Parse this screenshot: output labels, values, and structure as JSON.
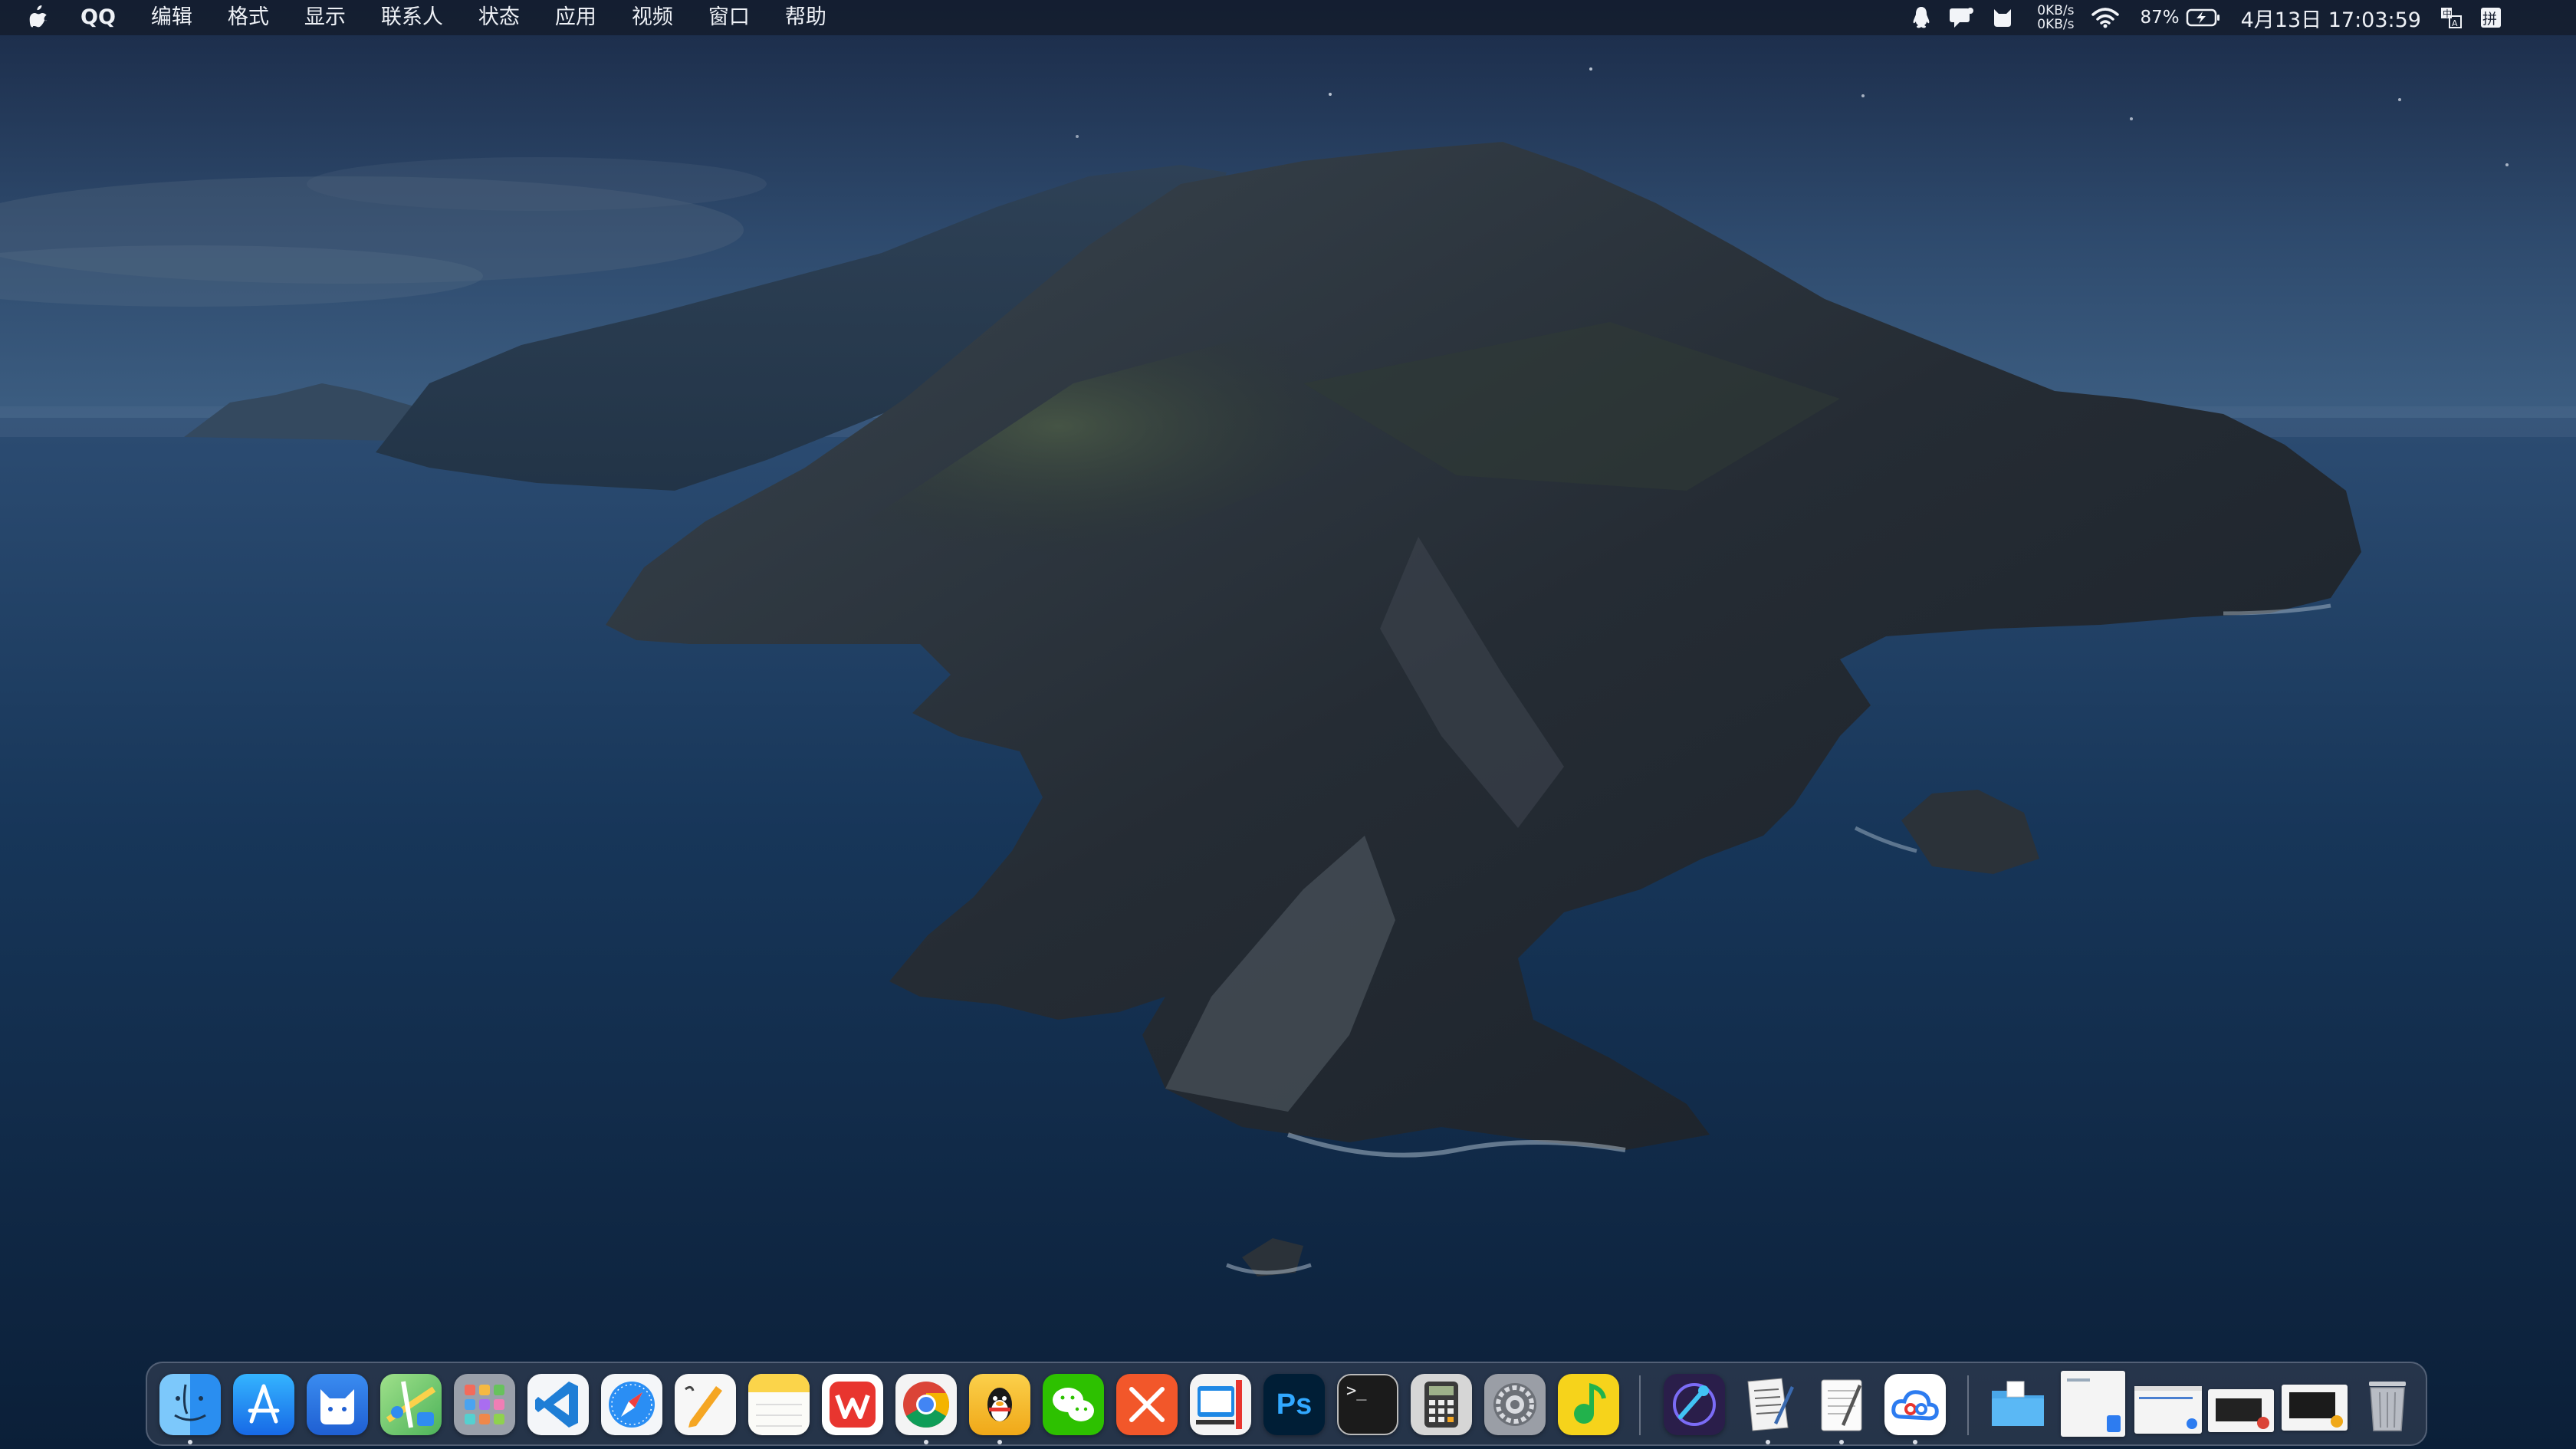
{
  "menubar": {
    "app_name": "QQ",
    "menus": [
      "编辑",
      "格式",
      "显示",
      "联系人",
      "状态",
      "应用",
      "视频",
      "窗口",
      "帮助"
    ],
    "net_up": "0KB/s",
    "net_down": "0KB/s",
    "battery": "87%",
    "datetime": "4月13日 17:03:59",
    "status_icons": [
      "qq-penguin-icon",
      "notification-chat-icon",
      "cat-icon",
      "wifi-icon",
      "battery-charging-icon",
      "input-method-icon",
      "pinyin-icon"
    ]
  },
  "dock": {
    "apps": [
      {
        "name": "Finder",
        "icon": "finder-icon",
        "color": "#3aa0f3",
        "running": true
      },
      {
        "name": "App Store",
        "icon": "app-store-icon",
        "color": "#1d8cf5",
        "running": false
      },
      {
        "name": "Cat App",
        "icon": "cat-app-icon",
        "color": "#2f7be8",
        "running": false
      },
      {
        "name": "Maps",
        "icon": "maps-icon",
        "color": "#6cc46a",
        "running": false
      },
      {
        "name": "Launchpad",
        "icon": "launchpad-icon",
        "color": "#8a8f98",
        "running": false
      },
      {
        "name": "Visual Studio Code",
        "icon": "vscode-icon",
        "color": "#1f7ed6",
        "running": false
      },
      {
        "name": "Safari",
        "icon": "safari-icon",
        "color": "#1f8ef1",
        "running": false
      },
      {
        "name": "Pages",
        "icon": "pages-icon",
        "color": "#f4f4f4",
        "running": false
      },
      {
        "name": "Notes",
        "icon": "notes-icon",
        "color": "#fbd44a",
        "running": false
      },
      {
        "name": "WPS Office",
        "icon": "wps-icon",
        "color": "#e8352f",
        "running": false
      },
      {
        "name": "Google Chrome",
        "icon": "chrome-icon",
        "color": "#f1f1f1",
        "running": true
      },
      {
        "name": "QQ",
        "icon": "qq-icon",
        "color": "#f2b51d",
        "running": true
      },
      {
        "name": "WeChat",
        "icon": "wechat-icon",
        "color": "#2dc100",
        "running": false
      },
      {
        "name": "XMind",
        "icon": "xmind-icon",
        "color": "#f2572a",
        "running": false
      },
      {
        "name": "Screen Tool",
        "icon": "screen-tool-icon",
        "color": "#1e88e5",
        "running": false
      },
      {
        "name": "Photoshop",
        "icon": "photoshop-icon",
        "color": "#001e36",
        "running": false
      },
      {
        "name": "Terminal",
        "icon": "terminal-icon",
        "color": "#1b1b1b",
        "running": false
      },
      {
        "name": "Calculator",
        "icon": "calculator-icon",
        "color": "#4a4a4a",
        "running": false
      },
      {
        "name": "System Preferences",
        "icon": "system-preferences-icon",
        "color": "#8e8e93",
        "running": false
      },
      {
        "name": "QQ Music",
        "icon": "qq-music-icon",
        "color": "#f6d31b",
        "running": false
      },
      {
        "name": "Instruments",
        "icon": "instruments-icon",
        "color": "#2a1e4a",
        "running": false
      },
      {
        "name": "Script Editor",
        "icon": "script-editor-icon",
        "color": "#e8e8e8",
        "running": true
      },
      {
        "name": "TextEdit",
        "icon": "textedit-icon",
        "color": "#f5f5f5",
        "running": true
      },
      {
        "name": "Baidu Netdisk",
        "icon": "cloud-drive-icon",
        "color": "#ffffff",
        "running": true
      }
    ],
    "right_items": [
      "downloads-folder-icon",
      "minimized-window-1",
      "minimized-window-2",
      "minimized-window-3",
      "minimized-window-4",
      "trash-icon"
    ]
  }
}
